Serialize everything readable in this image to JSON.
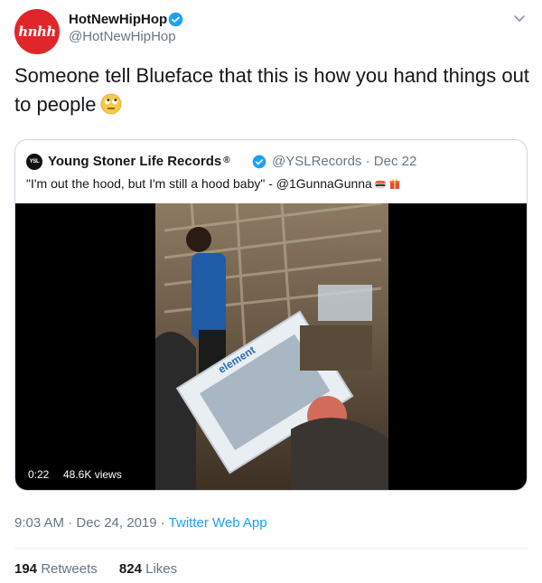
{
  "author": {
    "avatar_text": "hnhh",
    "name": "HotNewHipHop",
    "handle": "@HotNewHipHop"
  },
  "tweet": {
    "text": "Someone tell Blueface that this is how you hand things out to people",
    "emoji": "face-with-rolling-eyes"
  },
  "quote": {
    "avatar_text": "YSL",
    "name": "Young Stoner Life Records",
    "name_suffix": "®",
    "meta": "@YSLRecords · Dec 22",
    "text": "\"I'm out the hood, but I'm still a hood baby\" - @1GunnaGunna",
    "emojis": [
      "sushi-icon",
      "gift-icon"
    ],
    "video": {
      "duration": "0:22",
      "views": "48.6K views",
      "box_text": "element"
    }
  },
  "footer": {
    "time_date": "9:03 AM · Dec 24, 2019 · ",
    "source": "Twitter Web App",
    "retweets_count": "194",
    "retweets_label": "Retweets",
    "likes_count": "824",
    "likes_label": "Likes"
  },
  "colors": {
    "brand_red": "#e0262a",
    "link_blue": "#1da1f2",
    "muted": "#657786",
    "text": "#14171a"
  }
}
